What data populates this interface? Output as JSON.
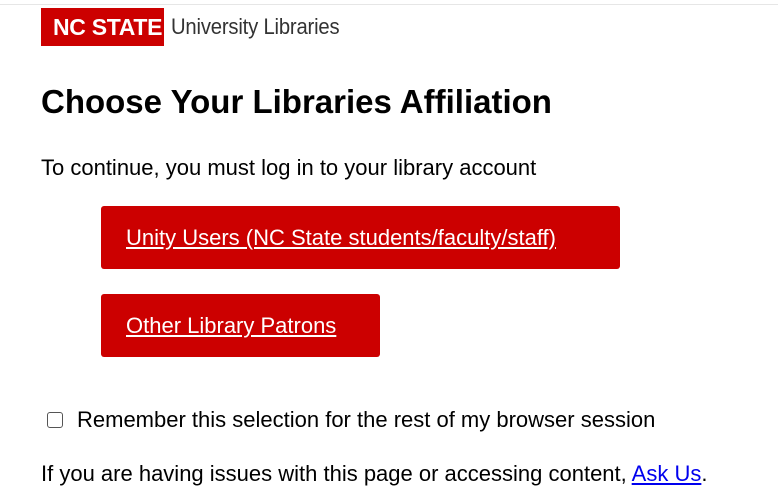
{
  "header": {
    "logo_badge": "NC STATE",
    "logo_text": "University Libraries"
  },
  "main": {
    "title": "Choose Your Libraries Affiliation",
    "intro": "To continue, you must log in to your library account",
    "buttons": {
      "unity_label": "Unity Users (NC State students/faculty/staff)",
      "other_label": "Other Library Patrons"
    },
    "remember": {
      "label": "Remember this selection for the rest of my browser session",
      "checked": false
    },
    "help": {
      "text": "If you are having issues with this page or accessing content, ",
      "link_label": "Ask Us",
      "trailing": "."
    }
  },
  "colors": {
    "brand_red": "#cc0000",
    "link_blue": "#0000ee"
  }
}
